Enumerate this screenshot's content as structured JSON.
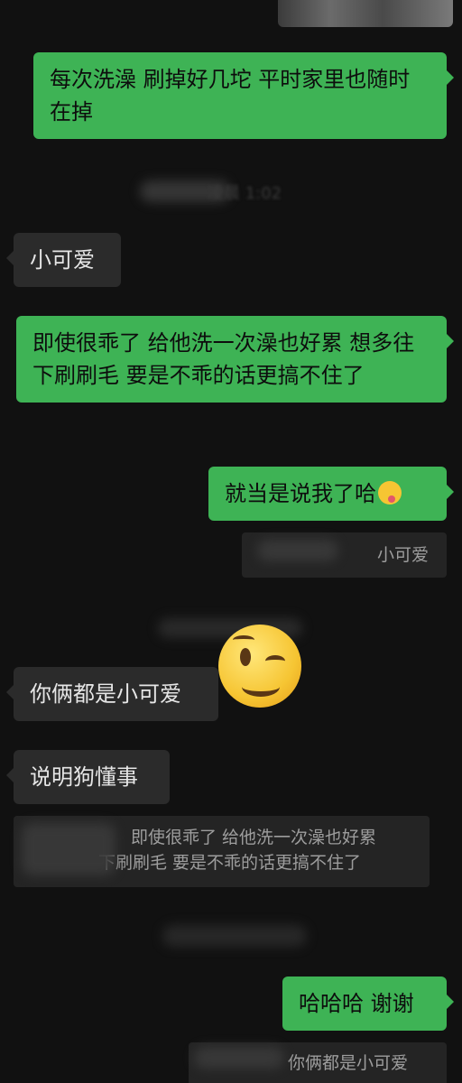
{
  "messages": [
    {
      "id": "m1",
      "text": "每次洗澡 刷掉好几坨 平时家里也随时在掉"
    },
    {
      "id": "m2",
      "text": "小可爱"
    },
    {
      "id": "m3",
      "text": "即使很乖了 给他洗一次澡也好累 想多往下刷刷毛 要是不乖的话更搞不住了"
    },
    {
      "id": "m4",
      "text": "就当是说我了哈"
    },
    {
      "id": "m5",
      "text": "你俩都是小可爱"
    },
    {
      "id": "m6",
      "text": "说明狗懂事"
    },
    {
      "id": "m7",
      "text": "哈哈哈 谢谢"
    }
  ],
  "quotes": {
    "q1": "小可爱",
    "q2_line1": "即使很乖了 给他洗一次澡也好累",
    "q2_line2": "下刷刷毛 要是不乖的话更搞不住了",
    "q3": "你俩都是小可爱"
  },
  "timestamps": {
    "t1": "凌晨 1:02"
  },
  "emoji": {
    "yum": "yum-emoji",
    "wink": "wink-emoji"
  }
}
